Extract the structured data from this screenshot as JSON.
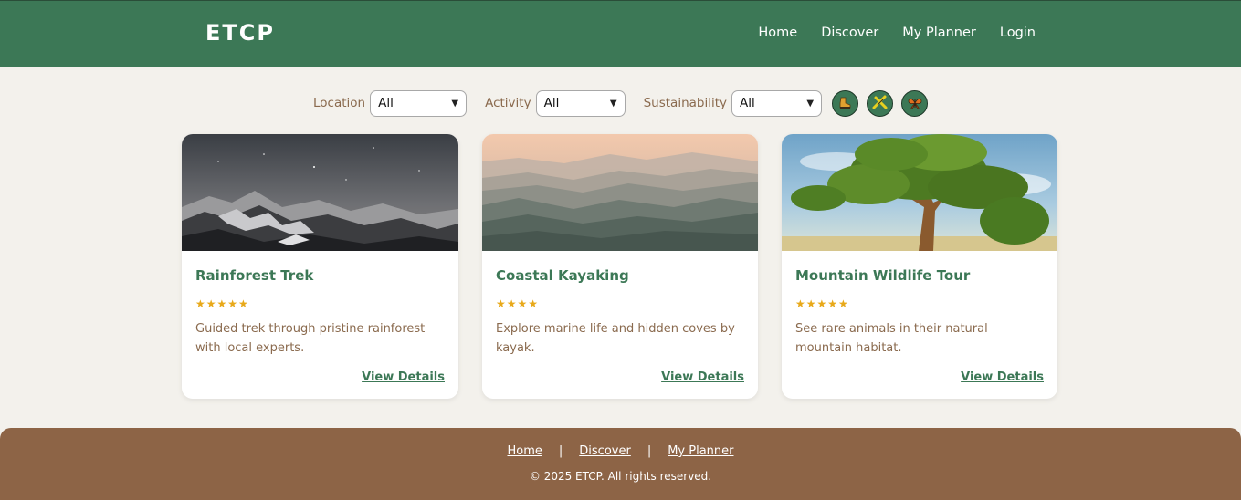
{
  "header": {
    "logo": "ETCP",
    "nav": [
      "Home",
      "Discover",
      "My Planner",
      "Login"
    ]
  },
  "filters": {
    "location": {
      "label": "Location",
      "value": "All"
    },
    "activity": {
      "label": "Activity",
      "value": "All"
    },
    "sustainability": {
      "label": "Sustainability",
      "value": "All"
    },
    "icons": [
      "hiking-boot-icon",
      "kayak-paddle-icon",
      "butterfly-icon"
    ]
  },
  "cards": [
    {
      "title": "Rainforest Trek",
      "stars": "★★★★★",
      "description": "Guided trek through pristine rainforest with local experts.",
      "link": "View Details"
    },
    {
      "title": "Coastal Kayaking",
      "stars": "★★★★",
      "description": "Explore marine life and hidden coves by kayak.",
      "link": "View Details"
    },
    {
      "title": "Mountain Wildlife Tour",
      "stars": "★★★★★",
      "description": "See rare animals in their natural mountain habitat.",
      "link": "View Details"
    }
  ],
  "footer": {
    "links": [
      "Home",
      "Discover",
      "My Planner"
    ],
    "separator": "|",
    "copyright": "© 2025 ETCP. All rights reserved."
  },
  "colors": {
    "primary_green": "#3c7856",
    "brown": "#8d6446",
    "star": "#e8a91a",
    "background": "#f3f1ec"
  }
}
